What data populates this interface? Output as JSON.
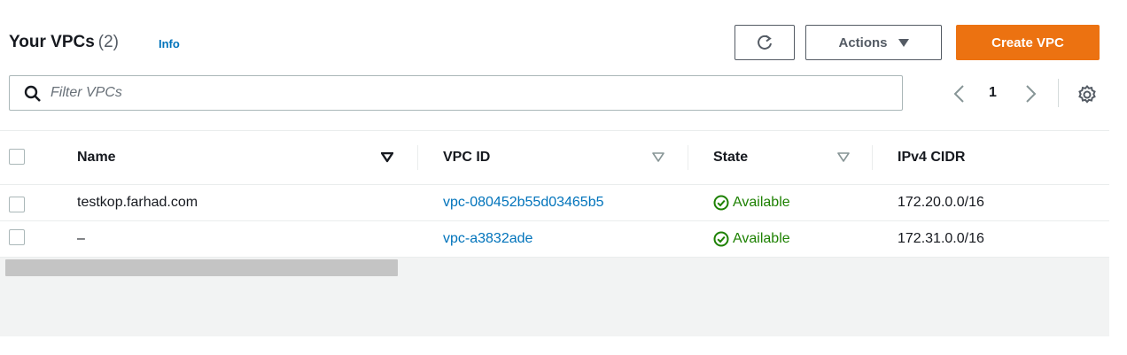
{
  "header": {
    "title": "Your VPCs",
    "count": "(2)",
    "info_label": "Info",
    "refresh_icon": "refresh-icon",
    "actions_label": "Actions",
    "create_label": "Create VPC"
  },
  "filter": {
    "placeholder": "Filter VPCs",
    "value": ""
  },
  "pagination": {
    "current_page": "1"
  },
  "table": {
    "columns": [
      "Name",
      "VPC ID",
      "State",
      "IPv4 CIDR"
    ],
    "rows": [
      {
        "name": "testkop.farhad.com",
        "vpc_id": "vpc-080452b55d03465b5",
        "state": "Available",
        "cidr": "172.20.0.0/16"
      },
      {
        "name": "–",
        "vpc_id": "vpc-a3832ade",
        "state": "Available",
        "cidr": "172.31.0.0/16"
      }
    ]
  },
  "colors": {
    "accent_orange": "#ec7211",
    "link_blue": "#0073bb",
    "status_green": "#1d8102"
  }
}
